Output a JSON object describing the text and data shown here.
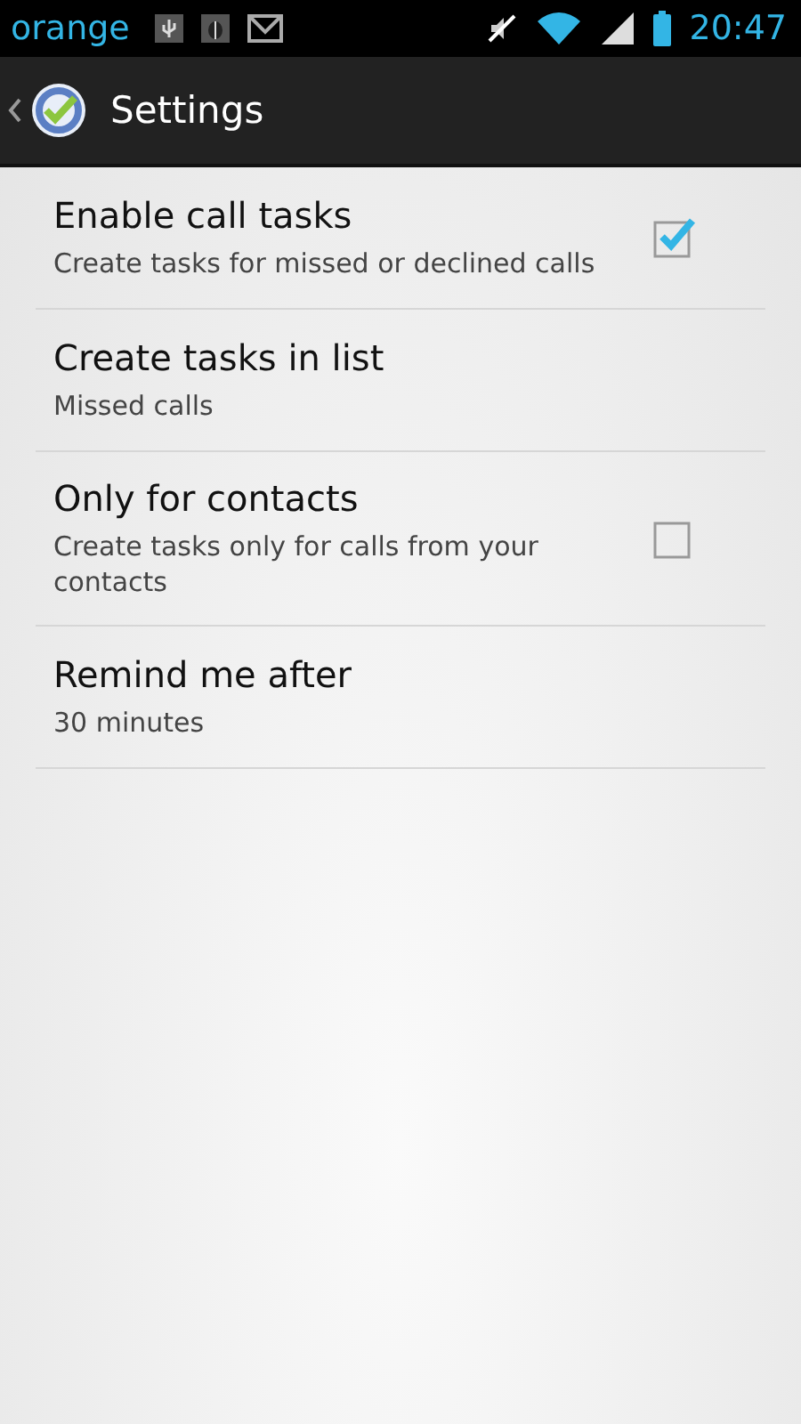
{
  "status_bar": {
    "carrier": "orange",
    "time": "20:47"
  },
  "action_bar": {
    "title": "Settings"
  },
  "settings": [
    {
      "kind": "checkbox",
      "title": "Enable call tasks",
      "summary": "Create tasks for missed or declined calls",
      "checked": true
    },
    {
      "kind": "text",
      "title": "Create tasks in list",
      "summary": "Missed calls"
    },
    {
      "kind": "checkbox",
      "title": "Only for contacts",
      "summary": "Create tasks only for calls from your contacts",
      "checked": false
    },
    {
      "kind": "text",
      "title": "Remind me after",
      "summary": "30 minutes"
    }
  ]
}
